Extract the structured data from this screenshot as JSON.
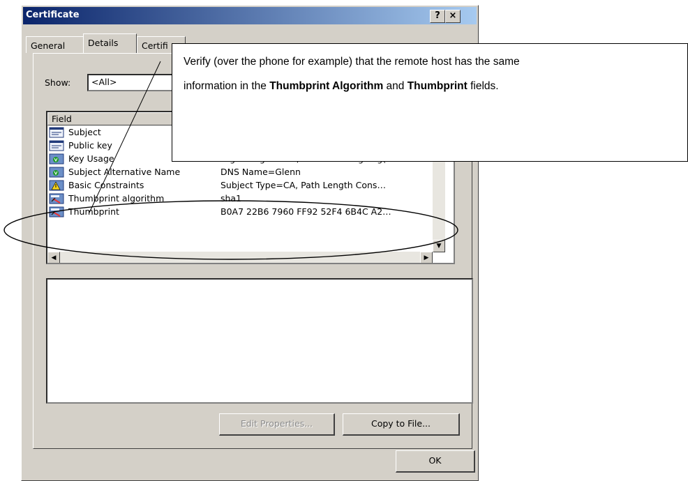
{
  "window": {
    "title": "Certificate",
    "help_label": "?",
    "close_label": "×"
  },
  "tabs": [
    {
      "label": "General"
    },
    {
      "label": "Details"
    },
    {
      "label": "Certifi"
    }
  ],
  "show": {
    "label": "Show:",
    "value": "<All>"
  },
  "list": {
    "column_field": "Field",
    "rows": [
      {
        "field": "Subject",
        "value": "",
        "icon": "certificate-field-icon"
      },
      {
        "field": "Public key",
        "value": "",
        "icon": "certificate-field-icon"
      },
      {
        "field": "Key Usage",
        "value": "Digital Signature , Certificate Signing(…",
        "icon": "extension-icon"
      },
      {
        "field": "Subject Alternative Name",
        "value": "DNS Name=Glenn",
        "icon": "extension-icon"
      },
      {
        "field": "Basic Constraints",
        "value": "Subject Type=CA, Path Length Cons…",
        "icon": "critical-extension-icon"
      },
      {
        "field": "Thumbprint algorithm",
        "value": "sha1",
        "icon": "property-icon"
      },
      {
        "field": "Thumbprint",
        "value": "B0A7 22B6 7960 FF92 52F4 6B4C A2…",
        "icon": "property-icon"
      }
    ]
  },
  "buttons": {
    "edit_properties": "Edit Properties...",
    "copy_to_file": "Copy to File...",
    "ok": "OK"
  },
  "callout": {
    "line1": "Verify (over the phone for example) that the remote host has the same",
    "line2_part1": "information in the ",
    "line2_bold1": "Thumbprint Algorithm",
    "line2_part2": " and ",
    "line2_bold2": "Thumbprint",
    "line2_part3": " fields."
  },
  "colors": {
    "title_start": "#0a246a",
    "title_end": "#a6caf0",
    "dialog_face": "#d4d0c8"
  }
}
